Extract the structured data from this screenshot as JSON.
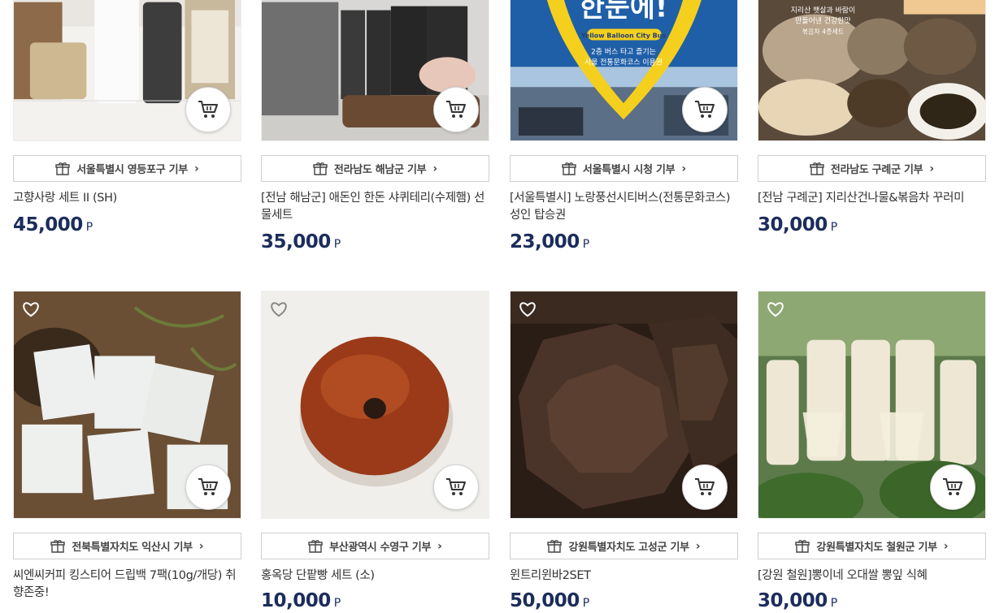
{
  "products": [
    {
      "title": "고향사랑 세트 II (SH)",
      "region": "서울특별시 영등포구 기부",
      "price": "45,000",
      "unit": "P",
      "image": "assez-gift-set",
      "wished": false
    },
    {
      "title": "[전남 해남군] 애돈인 한돈 샤퀴테리(수제햄) 선물세트",
      "region": "전라남도 해남군 기부",
      "price": "35,000",
      "unit": "P",
      "image": "charcuterie-set",
      "wished": false
    },
    {
      "title": "[서울특별시] 노랑풍선시티버스(전통문화코스) 성인 탑승권",
      "region": "서울특별시 시청 기부",
      "price": "23,000",
      "unit": "P",
      "image": "city-bus-ticket",
      "wished": false,
      "image_text": {
        "headline": "한눈에!",
        "badge": "Yellow Balloon City Bus",
        "line1": "2층 버스 타고 즐기는",
        "line2": "서울 전통문화코스 이용권"
      }
    },
    {
      "title": "[전남 구례군] 지리산건나물&볶음차 꾸러미",
      "region": "전라남도 구례군 기부",
      "price": "30,000",
      "unit": "P",
      "image": "dried-herbs-bundle",
      "wished": false,
      "image_text": {
        "line1": "지리산 햇살과 바람이",
        "line2": "만들어낸 건강한맛",
        "line3": "볶음차 4종세트"
      }
    },
    {
      "title": "씨엔씨커피 킹스티어 드립백 7팩(10g/개당) 취향존중!",
      "region": "전북특별자치도 익산시 기부",
      "price": "10,000",
      "unit": "P",
      "image": "drip-coffee-bags",
      "wished": false
    },
    {
      "title": "홍옥당 단팥빵 세트 (소)",
      "region": "부산광역시 수영구 기부",
      "price": "10,000",
      "unit": "P",
      "image": "red-bean-bread",
      "wished": false
    },
    {
      "title": "윈트리윈바2SET",
      "region": "강원특별자치도 고성군 기부",
      "price": "50,000",
      "unit": "P",
      "image": "chocolate-bars",
      "wished": false
    },
    {
      "title": "[강원 철원]뽕이네 오대쌀 뽕잎 식혜",
      "region": "강원특별자치도 철원군 기부",
      "price": "30,000",
      "unit": "P",
      "image": "mulberry-sikhye",
      "wished": false
    }
  ],
  "icons": {
    "cart": "cart-icon",
    "wishlist": "heart-icon",
    "donation": "gift-icon",
    "chevron": "chevron-right-icon"
  },
  "colors": {
    "price": "#1c2d5c",
    "border": "#cfcfcf",
    "text": "#333333"
  }
}
